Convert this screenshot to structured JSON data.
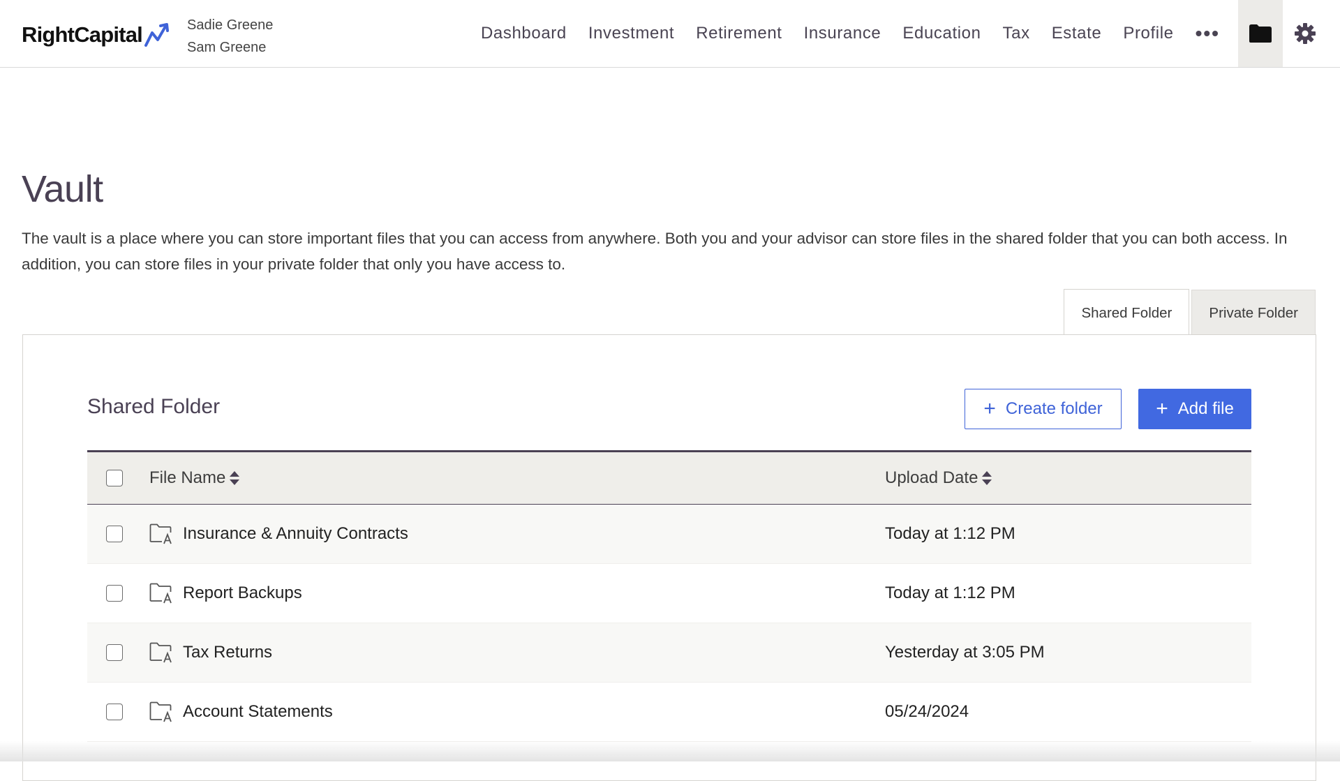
{
  "brand": {
    "name": "RightCapital",
    "accent": "#3f63d8"
  },
  "clients": [
    "Sadie Greene",
    "Sam Greene"
  ],
  "nav": {
    "items": [
      "Dashboard",
      "Investment",
      "Retirement",
      "Insurance",
      "Education",
      "Tax",
      "Estate",
      "Profile"
    ],
    "more_label": "•••",
    "vault_icon": "folder-icon",
    "settings_icon": "gear-icon"
  },
  "page": {
    "title": "Vault",
    "description": "The vault is a place where you can store important files that you can access from anywhere. Both you and your advisor can store files in the shared folder that you can both access. In addition, you can store files in your private folder that only you have access to."
  },
  "tabs": [
    {
      "label": "Shared Folder",
      "active": true
    },
    {
      "label": "Private Folder",
      "active": false
    }
  ],
  "section": {
    "title": "Shared Folder",
    "create_folder_label": "Create folder",
    "add_file_label": "Add file"
  },
  "table": {
    "columns": {
      "name": "File Name",
      "date": "Upload Date"
    },
    "rows": [
      {
        "name": "Insurance & Annuity Contracts",
        "date": "Today at 1:12 PM"
      },
      {
        "name": "Report Backups",
        "date": "Today at 1:12 PM"
      },
      {
        "name": "Tax Returns",
        "date": "Yesterday at 3:05 PM"
      },
      {
        "name": "Account Statements",
        "date": "05/24/2024"
      }
    ]
  }
}
